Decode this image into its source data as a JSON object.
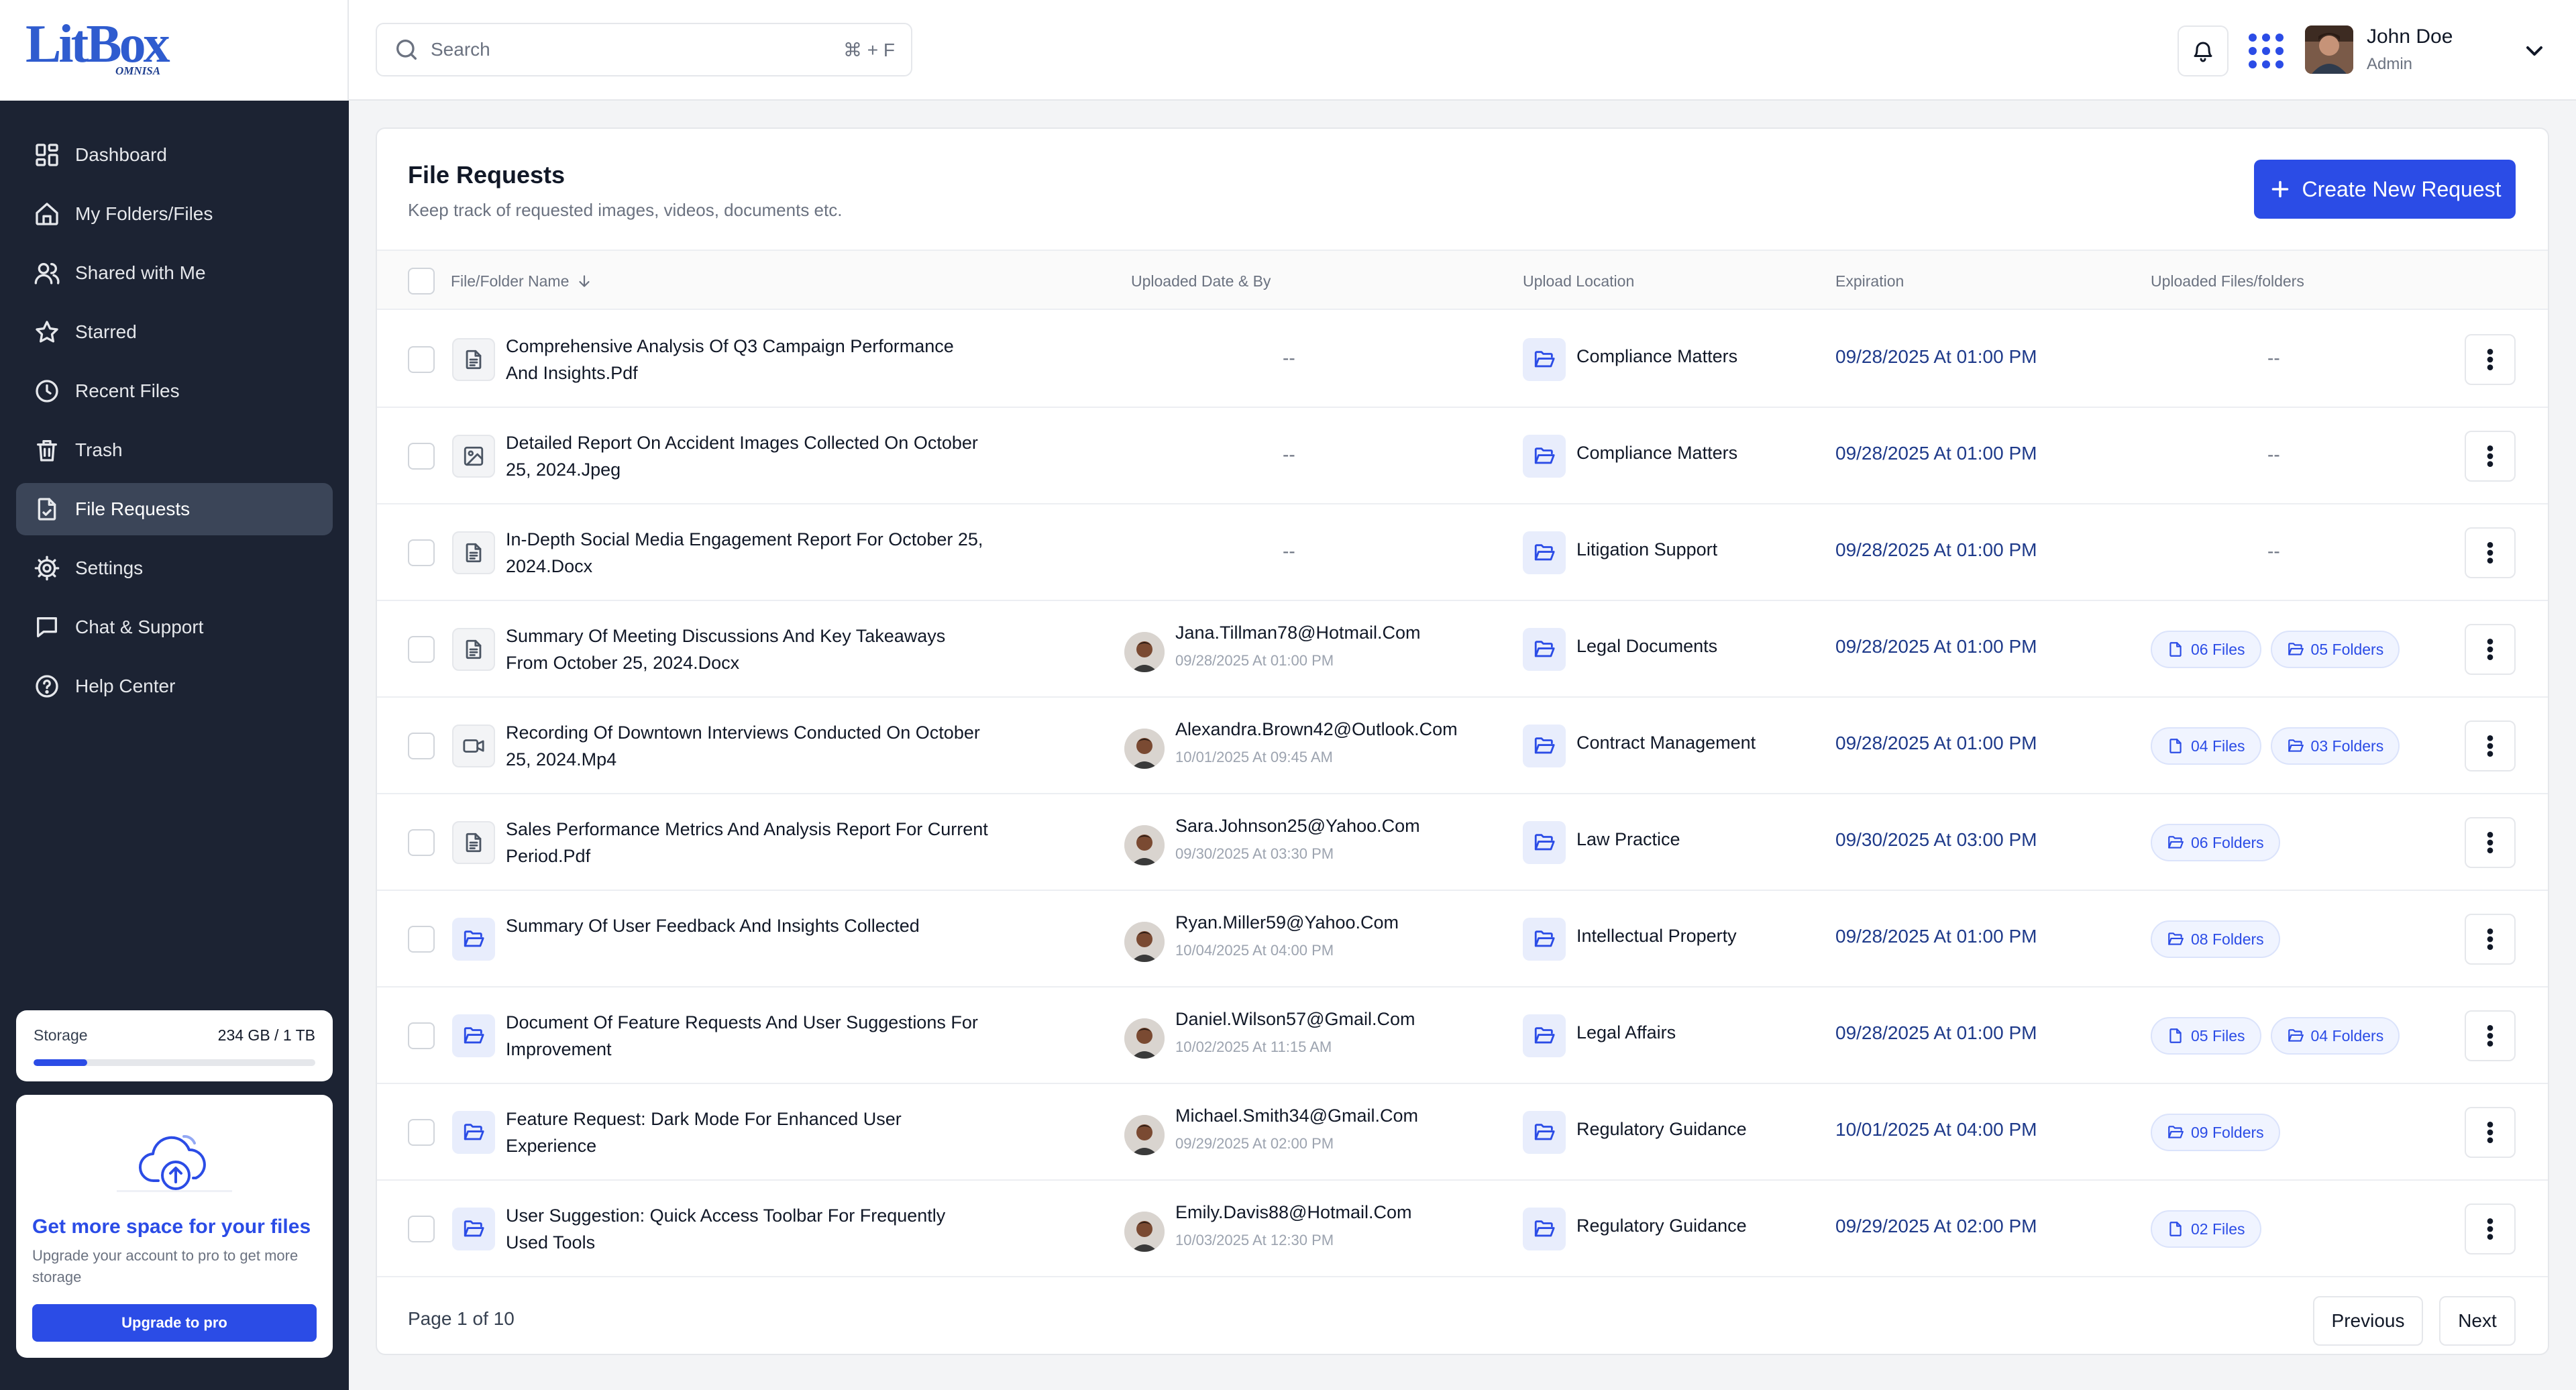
{
  "brand": {
    "logo_text": "LitBox",
    "logo_sub": "OMNISA"
  },
  "sidebar": {
    "items": [
      {
        "label": "Dashboard",
        "icon": "dashboard-icon"
      },
      {
        "label": "My Folders/Files",
        "icon": "home-icon"
      },
      {
        "label": "Shared with Me",
        "icon": "users-icon"
      },
      {
        "label": "Starred",
        "icon": "star-icon"
      },
      {
        "label": "Recent Files",
        "icon": "clock-icon"
      },
      {
        "label": "Trash",
        "icon": "trash-icon"
      },
      {
        "label": "File Requests",
        "icon": "file-request-icon",
        "active": true
      },
      {
        "label": "Settings",
        "icon": "gear-icon"
      },
      {
        "label": "Chat & Support",
        "icon": "chat-icon"
      },
      {
        "label": "Help Center",
        "icon": "help-icon"
      }
    ],
    "storage": {
      "label": "Storage",
      "used": "234 GB / 1 TB",
      "fraction": 0.19
    },
    "upgrade": {
      "title": "Get more space for your files",
      "text": "Upgrade your account to pro to get more storage",
      "button": "Upgrade to pro"
    }
  },
  "topbar": {
    "search_placeholder": "Search",
    "shortcut": "⌘ + F",
    "user_name": "John Doe",
    "user_role": "Admin"
  },
  "page": {
    "title": "File Requests",
    "subtitle": "Keep track of requested images, videos, documents etc.",
    "create_button": "Create New Request"
  },
  "table": {
    "columns": [
      "File/Folder Name",
      "Uploaded Date & By",
      "Upload Location",
      "Expiration",
      "Uploaded Files/folders"
    ],
    "rows": [
      {
        "name": "Comprehensive Analysis Of Q3 Campaign Performance And Insights.Pdf",
        "type": "doc",
        "uploader": null,
        "location": "Compliance Matters",
        "expiration": "09/28/2025 At 01:00 PM",
        "files": null,
        "folders": null
      },
      {
        "name": "Detailed Report On Accident Images Collected On October 25, 2024.Jpeg",
        "type": "image",
        "uploader": null,
        "location": "Compliance Matters",
        "expiration": "09/28/2025 At 01:00 PM",
        "files": null,
        "folders": null
      },
      {
        "name": "In-Depth Social Media Engagement Report For October 25, 2024.Docx",
        "type": "doc",
        "uploader": null,
        "location": "Litigation Support",
        "expiration": "09/28/2025 At 01:00 PM",
        "files": null,
        "folders": null
      },
      {
        "name": "Summary Of Meeting Discussions And Key Takeaways From October 25, 2024.Docx",
        "type": "doc",
        "uploader": {
          "email": "Jana.Tillman78@Hotmail.Com",
          "date": "09/28/2025 At 01:00 PM"
        },
        "location": "Legal Documents",
        "expiration": "09/28/2025 At 01:00 PM",
        "files": "06 Files",
        "folders": "05 Folders"
      },
      {
        "name": "Recording Of Downtown Interviews Conducted On October 25, 2024.Mp4",
        "type": "video",
        "uploader": {
          "email": "Alexandra.Brown42@Outlook.Com",
          "date": "10/01/2025 At 09:45 AM"
        },
        "location": "Contract Management",
        "expiration": "09/28/2025 At 01:00 PM",
        "files": "04 Files",
        "folders": "03 Folders"
      },
      {
        "name": "Sales Performance Metrics And Analysis Report For Current Period.Pdf",
        "type": "doc",
        "uploader": {
          "email": "Sara.Johnson25@Yahoo.Com",
          "date": "09/30/2025 At 03:30 PM"
        },
        "location": "Law Practice",
        "expiration": "09/30/2025 At 03:00 PM",
        "files": null,
        "folders": "06 Folders"
      },
      {
        "name": "Summary Of User Feedback And Insights Collected",
        "type": "folder",
        "uploader": {
          "email": "Ryan.Miller59@Yahoo.Com",
          "date": "10/04/2025 At 04:00 PM"
        },
        "location": "Intellectual Property",
        "expiration": "09/28/2025 At 01:00 PM",
        "files": null,
        "folders": "08 Folders"
      },
      {
        "name": "Document Of Feature Requests And User Suggestions For Improvement",
        "type": "folder",
        "uploader": {
          "email": "Daniel.Wilson57@Gmail.Com",
          "date": "10/02/2025 At 11:15 AM"
        },
        "location": "Legal Affairs",
        "expiration": "09/28/2025 At 01:00 PM",
        "files": "05 Files",
        "folders": "04 Folders"
      },
      {
        "name": "Feature Request: Dark Mode For Enhanced User Experience",
        "type": "folder",
        "uploader": {
          "email": "Michael.Smith34@Gmail.Com",
          "date": "09/29/2025 At 02:00 PM"
        },
        "location": "Regulatory Guidance",
        "expiration": "10/01/2025 At 04:00 PM",
        "files": null,
        "folders": "09 Folders"
      },
      {
        "name": "User Suggestion: Quick Access Toolbar For Frequently Used Tools",
        "type": "folder",
        "uploader": {
          "email": "Emily.Davis88@Hotmail.Com",
          "date": "10/03/2025 At 12:30 PM"
        },
        "location": "Regulatory Guidance",
        "expiration": "09/29/2025 At 02:00 PM",
        "files": "02 Files",
        "folders": null
      }
    ],
    "empty_marker": "--"
  },
  "pagination": {
    "info": "Page 1 of 10",
    "previous": "Previous",
    "next": "Next"
  }
}
